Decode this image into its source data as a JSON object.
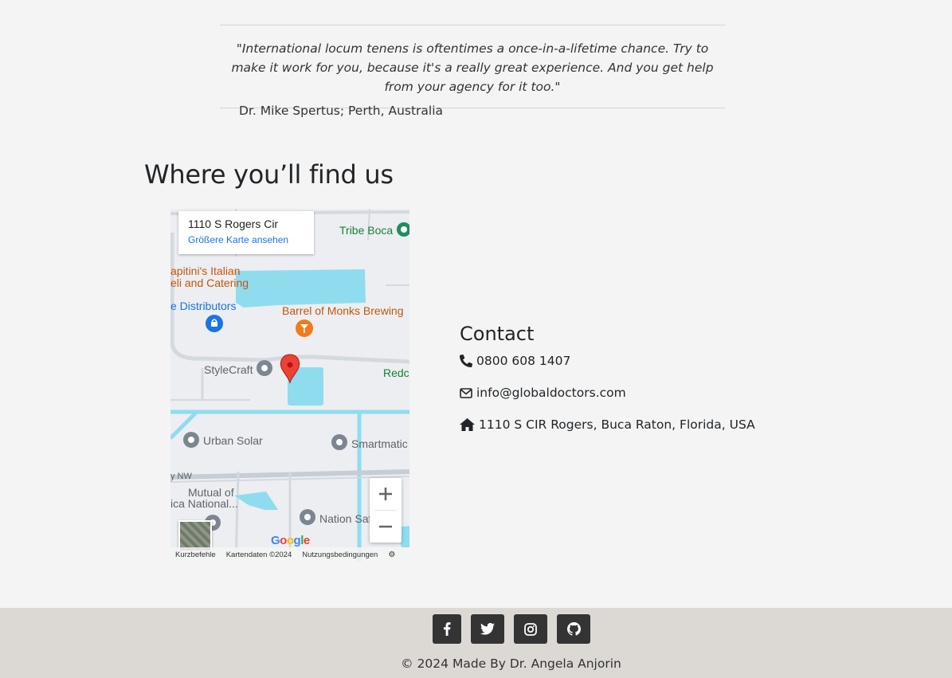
{
  "testimonial": {
    "quote": "\"International locum tenens is oftentimes a once-in-a-lifetime chance. Try to make it work for you, because it's a really great experience. And you get help from your agency for it too.\"",
    "author": "Dr. Mike Spertus; Perth, Australia"
  },
  "location": {
    "title": "Where you’ll find us"
  },
  "map": {
    "card_title": "1110 S Rogers Cir",
    "card_link": "Größere Karte ansehen",
    "pois": {
      "tribe_boca": "Tribe Boca",
      "capitinis_1": "apitini's Italian",
      "capitinis_2": "eli and Catering",
      "distributors": "e Distributors",
      "barrel": "Barrel of Monks Brewing",
      "stylecraft": "StyleCraft",
      "redco": "Redco",
      "urban_solar": "Urban Solar",
      "smartmatic": "Smartmatic",
      "nw": "y NW",
      "mutual_1": "Mutual of",
      "mutual_2": "ica National...",
      "nation_safe": "Nation Saf"
    },
    "google": "Google",
    "footer": {
      "shortcuts": "Kurzbefehle",
      "map_data": "Kartendaten ©2024",
      "terms": "Nutzungsbedingungen"
    },
    "zoom_in": "+",
    "zoom_out": "−"
  },
  "contact": {
    "title": "Contact",
    "phone": "0800 608 1407",
    "email": "info@globaldoctors.com",
    "address": "1110 S CIR Rogers, Buca Raton, Florida, USA"
  },
  "footer": {
    "copyright": "© 2024 Made By Dr. Angela Anjorin"
  }
}
